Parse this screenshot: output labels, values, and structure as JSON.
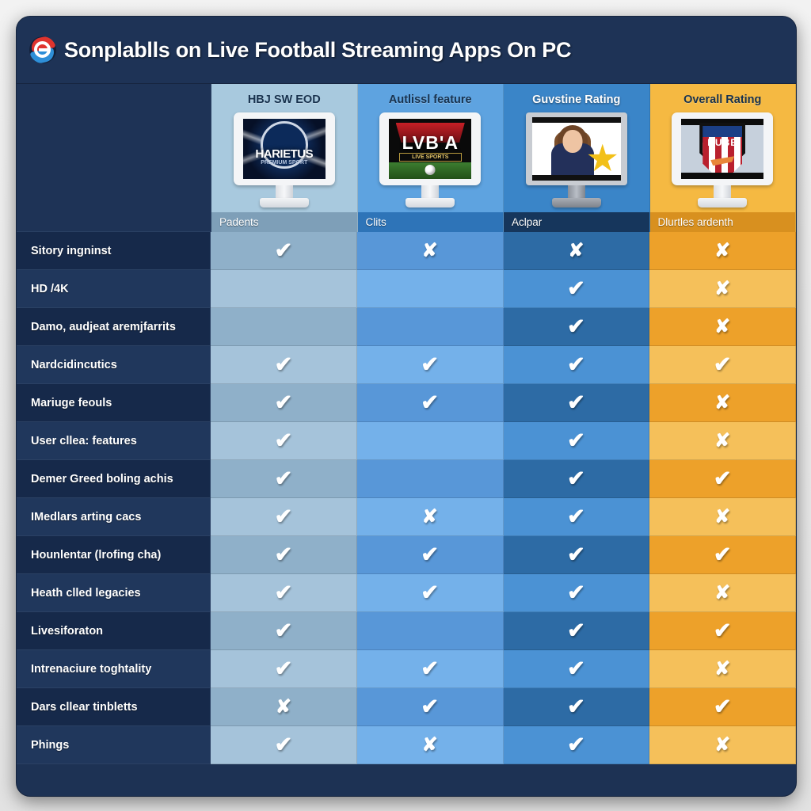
{
  "header": {
    "title": "Sonplablls on Live Football Streaming Apps On PC",
    "logo_icon": "e-browser-logo-icon"
  },
  "colors": {
    "card_bg": "#1d3254",
    "titlebar_bg": "#1e3356",
    "col1_header": "#a8c9de",
    "col2_header": "#5ea3e0",
    "col3_header": "#3a85c8",
    "col4_header": "#f5b942",
    "col1_row_a": "#8fb0c9",
    "col1_row_b": "#a5c3da",
    "col2_row_a": "#5897d8",
    "col2_row_b": "#74b1ea",
    "col3_row_a": "#2d6ba5",
    "col3_row_b": "#4b92d4",
    "col4_row_a": "#eda12a",
    "col4_row_b": "#f5c05a",
    "label_row_a": "#16294a",
    "label_row_b": "#20375c",
    "tick_glyph": "#ffffff",
    "cross_glyph": "#ffffff"
  },
  "columns": [
    {
      "name": "HBJ SW EOD",
      "sub": "Padents",
      "screen": "shield",
      "dark_title": false
    },
    {
      "name": "Autlissl feature",
      "sub": "Clits",
      "screen": "lvba",
      "dark_title": false
    },
    {
      "name": "Guvstine Rating",
      "sub": "Aclpar",
      "screen": "person",
      "dark_title": true
    },
    {
      "name": "Overall Rating",
      "sub": "Dlurtles ardenth",
      "screen": "rube",
      "dark_title": false
    }
  ],
  "screen_art": {
    "shield": {
      "word": "HARIETUS",
      "sub": "PREMIUM SPORT"
    },
    "lvba": {
      "word": "LVB'A",
      "sub": "LIVE  SPORTS"
    },
    "rube": {
      "word": "RUBE"
    }
  },
  "chart_data": {
    "type": "table",
    "title": "Sonplablls on Live Football Streaming Apps On PC",
    "columns": [
      "HBJ SW EOD",
      "Autlissl feature",
      "Guvstine Rating",
      "Overall Rating"
    ],
    "row_label_header": "",
    "legend": {
      "tick": "supported",
      "cross": "not supported",
      "blank": "not applicable"
    },
    "rows": [
      {
        "label": "Sitory ingninst",
        "values": [
          "tick",
          "cross",
          "cross",
          "cross"
        ]
      },
      {
        "label": "HD /4K",
        "values": [
          "blank",
          "blank",
          "tick",
          "cross"
        ]
      },
      {
        "label": "Damo, audjeat aremjfarrits",
        "values": [
          "blank",
          "blank",
          "tick",
          "cross"
        ]
      },
      {
        "label": "Nardcidincutics",
        "values": [
          "tick",
          "tick",
          "tick",
          "tick"
        ]
      },
      {
        "label": "Mariuge feouls",
        "values": [
          "tick",
          "tick",
          "tick",
          "cross"
        ]
      },
      {
        "label": "User cllea: features",
        "values": [
          "tick",
          "blank",
          "tick",
          "cross"
        ]
      },
      {
        "label": "Demer Greed boling achis",
        "values": [
          "tick",
          "blank",
          "tick",
          "tick"
        ]
      },
      {
        "label": "IMedlars arting cacs",
        "values": [
          "tick",
          "cross",
          "tick",
          "cross"
        ]
      },
      {
        "label": "Hounlentar (lrofing cha)",
        "values": [
          "tick",
          "tick",
          "tick",
          "tick"
        ]
      },
      {
        "label": "Heath clled legacies",
        "values": [
          "tick",
          "tick",
          "tick",
          "cross"
        ]
      },
      {
        "label": "Livesiforaton",
        "values": [
          "tick",
          "blank",
          "tick",
          "tick"
        ]
      },
      {
        "label": "Intrenaciure toghtality",
        "values": [
          "tick",
          "tick",
          "tick",
          "cross"
        ]
      },
      {
        "label": "Dars cllear tinbletts",
        "values": [
          "cross",
          "tick",
          "tick",
          "tick"
        ]
      },
      {
        "label": "Phings",
        "values": [
          "tick",
          "cross",
          "tick",
          "cross"
        ]
      }
    ]
  },
  "glyphs": {
    "tick": "✔",
    "cross": "✘"
  }
}
